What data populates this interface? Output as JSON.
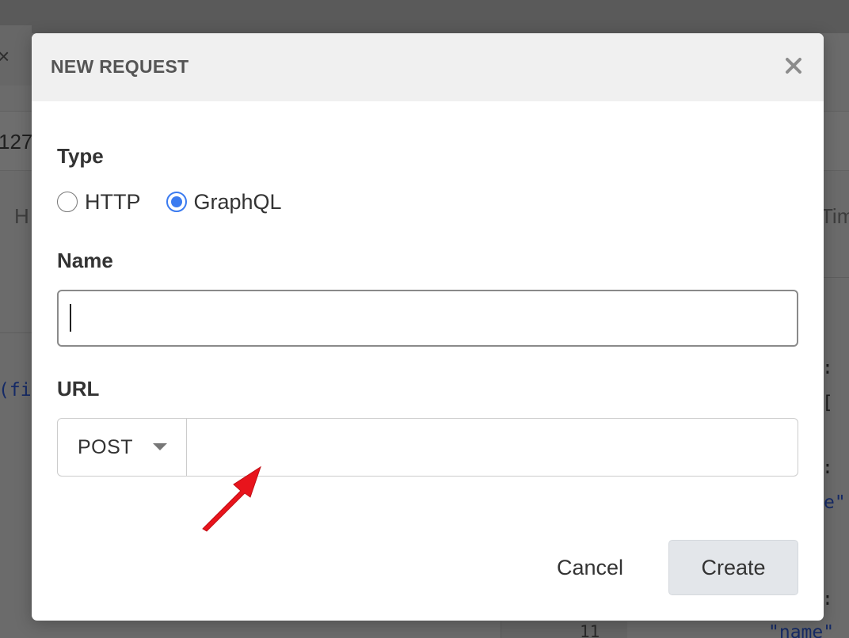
{
  "background": {
    "url_fragment": "127",
    "subtab_left": "H",
    "subtab_right": "Tim",
    "code_left": "(fi",
    "code_right": [
      ":",
      "[",
      ":",
      "e\"",
      ":",
      "\"name\""
    ],
    "line_number": "11"
  },
  "modal": {
    "title": "NEW REQUEST",
    "close_glyph": "×",
    "type": {
      "label": "Type",
      "options": [
        {
          "label": "HTTP",
          "checked": false
        },
        {
          "label": "GraphQL",
          "checked": true
        }
      ]
    },
    "name": {
      "label": "Name",
      "value": "",
      "placeholder": ""
    },
    "url": {
      "label": "URL",
      "method": "POST",
      "value": "",
      "placeholder": ""
    },
    "buttons": {
      "cancel": "Cancel",
      "create": "Create"
    }
  },
  "colors": {
    "accent": "#3b7bf0",
    "annotation_arrow": "#e8141c",
    "overlay": "#6b6b6b"
  }
}
